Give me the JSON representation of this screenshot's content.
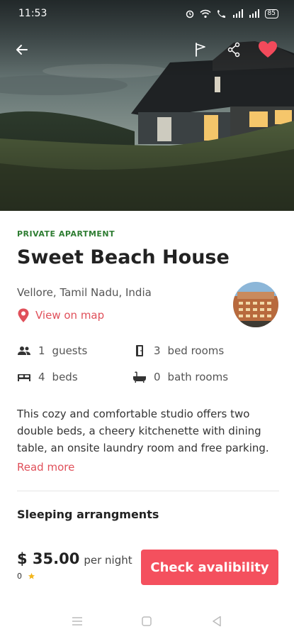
{
  "status_bar": {
    "time": "11:53",
    "battery": "85"
  },
  "header": {
    "back_icon": "arrow-left-icon",
    "report_icon": "flag-icon",
    "share_icon": "share-icon",
    "favorite_icon": "heart-icon",
    "favorite_color": "#f24a5b"
  },
  "listing": {
    "category": "PRIVATE APARTMENT",
    "title": "Sweet Beach House",
    "location": "Vellore, Tamil Nadu, India",
    "map_link": "View on map",
    "facts": [
      {
        "icon": "guests-icon",
        "count": "1",
        "label": "guests"
      },
      {
        "icon": "door-icon",
        "count": "3",
        "label": "bed rooms"
      },
      {
        "icon": "bed-icon",
        "count": "4",
        "label": "beds"
      },
      {
        "icon": "bathtub-icon",
        "count": "0",
        "label": "bath rooms"
      }
    ],
    "description": "This cozy and comfortable studio offers two double beds, a cheery kitchenette with dining table, an onsite laundry room and free parking.",
    "read_more": "Read more",
    "section_title": "Sleeping arrangments"
  },
  "booking": {
    "price": "$ 35.00",
    "per": "per night",
    "rating": "0",
    "cta": "Check avalibility"
  },
  "colors": {
    "accent": "#f4505e",
    "category_green": "#2e7d32"
  }
}
